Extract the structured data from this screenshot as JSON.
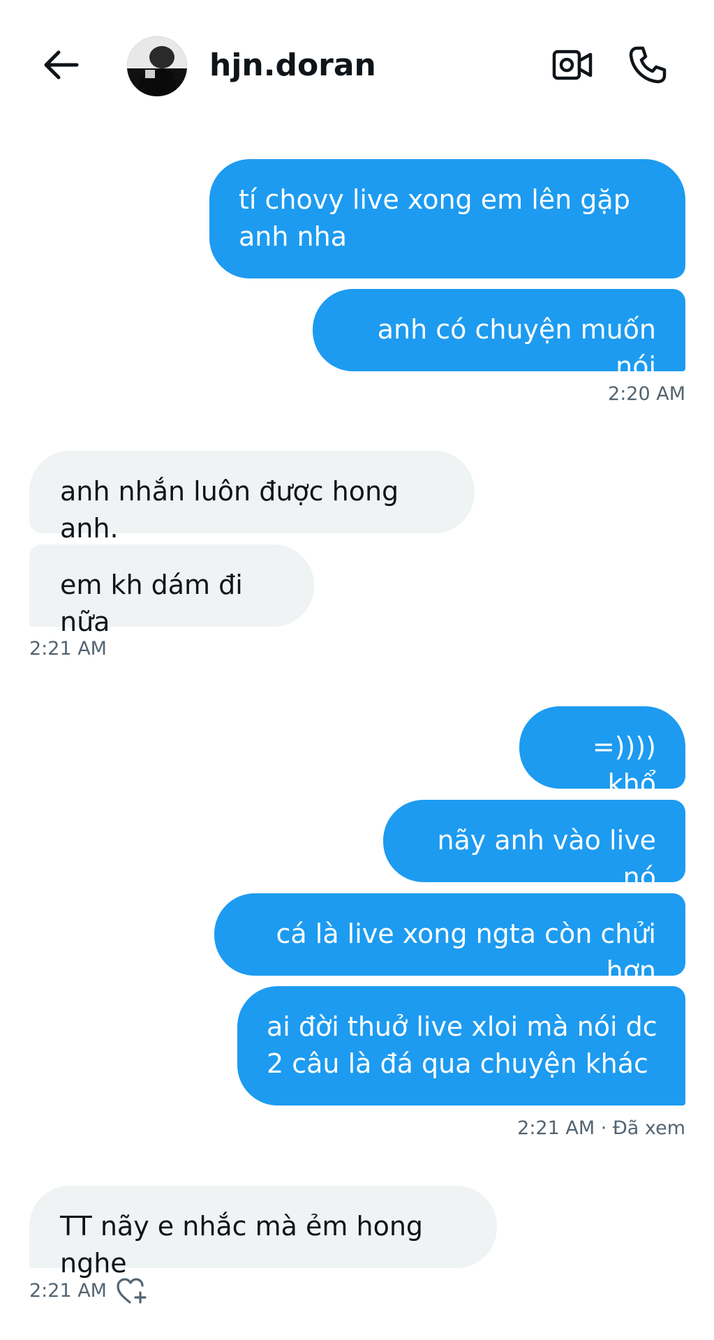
{
  "header": {
    "back_icon": "arrow-left-icon",
    "username": "hjn.doran",
    "video_icon": "video-camera-icon",
    "call_icon": "phone-icon"
  },
  "colors": {
    "outgoing_bubble": "#1d9bf0",
    "incoming_bubble": "#eff3f4",
    "text_primary": "#0f1419",
    "text_secondary": "#536471"
  },
  "messages": [
    {
      "direction": "out",
      "text": "tí chovy live xong em lên gặp anh nha"
    },
    {
      "direction": "out",
      "text": "anh có chuyện muốn nói"
    },
    {
      "direction": "in",
      "text": "anh nhắn luôn được hong anh."
    },
    {
      "direction": "in",
      "text": "em kh dám đi nữa"
    },
    {
      "direction": "out",
      "text": "=)))) khổ"
    },
    {
      "direction": "out",
      "text": "nãy anh vào live nó"
    },
    {
      "direction": "out",
      "text": "cá là live xong ngta còn chửi hơn"
    },
    {
      "direction": "out",
      "text": "ai đời thuở live xloi mà nói dc 2 câu là đá qua chuyện khác"
    },
    {
      "direction": "in",
      "text": "TT nãy e nhắc mà ẻm hong nghe"
    }
  ],
  "timestamps": {
    "t1": "2:20 AM",
    "t2": "2:21 AM",
    "t3": "2:21 AM · Đã xem",
    "t4": "2:21 AM"
  },
  "reaction_icon": "heart-plus-icon"
}
